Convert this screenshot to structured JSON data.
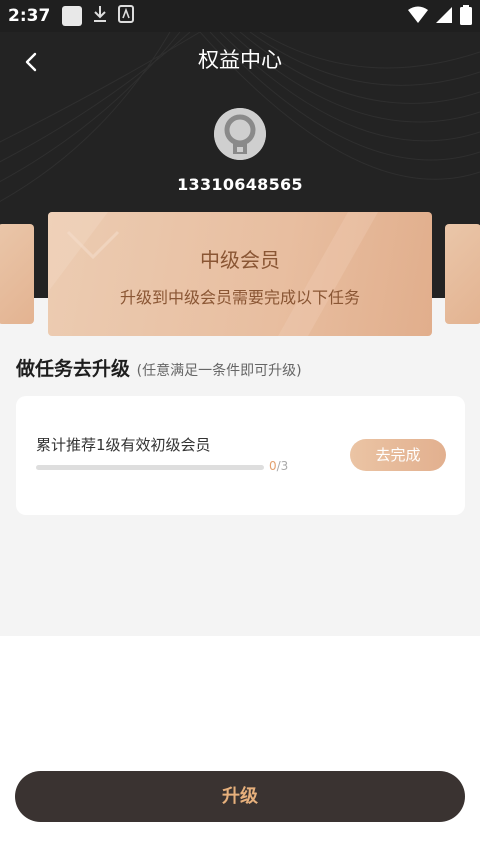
{
  "status_bar": {
    "time": "2:37",
    "icons": [
      "notification-square-icon",
      "download-icon",
      "app-a-icon",
      "wifi-icon",
      "signal-icon",
      "battery-icon"
    ]
  },
  "header": {
    "title": "权益中心",
    "back_icon": "chevron-left-icon",
    "phone": "13310648565"
  },
  "level_card": {
    "name": "中级会员",
    "description": "升级到中级会员需要完成以下任务"
  },
  "tasks_section": {
    "title": "做任务去升级",
    "subtitle": "(任意满足一条件即可升级)",
    "tasks": [
      {
        "name": "累计推荐1级有效初级会员",
        "current": "0",
        "total": "/3",
        "progress": 0.0,
        "action_label": "去完成"
      }
    ]
  },
  "footer": {
    "upgrade_label": "升级"
  },
  "colors": {
    "header_bg": "#232323",
    "card_gold": "#e8bea0",
    "accent_text": "#8a5634",
    "button_dark": "#3a3331",
    "button_text": "#e6b07c"
  }
}
